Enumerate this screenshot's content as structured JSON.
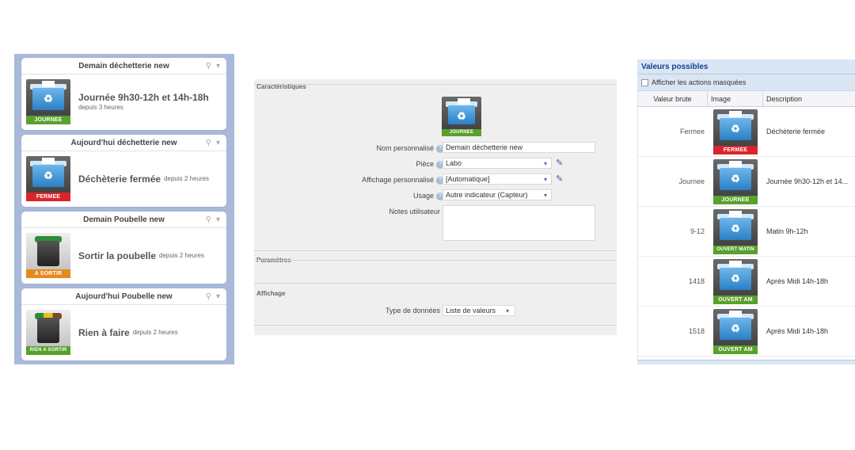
{
  "widgets": [
    {
      "title": "Demain déchetterie new",
      "value": "Journée 9h30-12h et 14h-18h",
      "since": "depuis 3 heures",
      "icon": "recycling-bin-icon",
      "band": "JOURNEE",
      "band_color": "#5aa02c"
    },
    {
      "title": "Aujourd'hui déchetterie new",
      "value": "Déchèterie fermée",
      "since": "depuis 2 heures",
      "icon": "recycling-bin-icon",
      "band": "FERMEE",
      "band_color": "#d9262c"
    },
    {
      "title": "Demain Poubelle new",
      "value": "Sortir la poubelle",
      "since": "depuis 2 heures",
      "icon": "trash-can-icon",
      "band": "A SORTIR",
      "band_color": "#e58a1e"
    },
    {
      "title": "Aujourd'hui Poubelle new",
      "value": "Rien à faire",
      "since": "depuis 2 heures",
      "icon": "trash-can-icon",
      "band": "RIEN A SORTIR",
      "band_color": "#5aa02c"
    }
  ],
  "form": {
    "section_characteristics": "Caractéristiques",
    "preview_band": "JOURNEE",
    "name_label": "Nom personnalisé",
    "name_value": "Demain déchetterie new",
    "room_label": "Pièce",
    "room_value": "Labo",
    "display_label": "Affichage personnalisé",
    "display_value": "[Automatique]",
    "usage_label": "Usage",
    "usage_value": "Autre indicateur (Capteur)",
    "notes_label": "Notes utilisateur",
    "notes_value": "",
    "section_params": "Paramètres",
    "section_display": "Affichage",
    "datatype_label": "Type de données",
    "datatype_value": "Liste de valeurs"
  },
  "values_panel": {
    "title": "Valeurs possibles",
    "show_hidden_label": "Afficher les actions masquées",
    "col_raw": "Valeur brute",
    "col_image": "Image",
    "col_desc": "Description",
    "rows": [
      {
        "raw": "Fermee",
        "band": "FERMEE",
        "band_color": "#d9262c",
        "desc": "Déchèterie fermée"
      },
      {
        "raw": "Journee",
        "band": "JOURNEE",
        "band_color": "#5aa02c",
        "desc": "Journée 9h30-12h et 14..."
      },
      {
        "raw": "9-12",
        "band": "OUVERT MATIN",
        "band_color": "#5aa02c",
        "desc": "Matin 9h-12h"
      },
      {
        "raw": "1418",
        "band": "OUVERT AM",
        "band_color": "#5aa02c",
        "desc": "Après Midi 14h-18h"
      },
      {
        "raw": "1518",
        "band": "OUVERT AM",
        "band_color": "#5aa02c",
        "desc": "Après Midi 14h-18h"
      }
    ]
  },
  "colors": {
    "panel_bg": "#a8b9da",
    "header_blue": "#15428b"
  }
}
